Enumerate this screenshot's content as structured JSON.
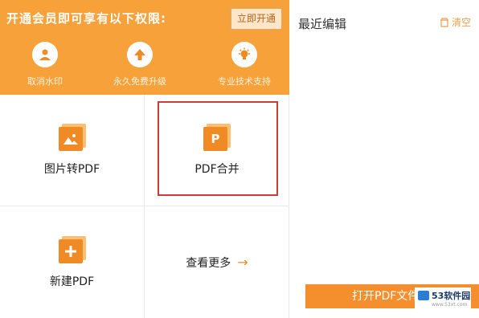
{
  "banner": {
    "title": "开通会员即可享有以下权限:",
    "activate_button": "立即开通",
    "perks": [
      {
        "label": "取消水印",
        "icon": "user-stamp-icon"
      },
      {
        "label": "永久免费升级",
        "icon": "upgrade-arrow-icon"
      },
      {
        "label": "专业技术支持",
        "icon": "support-bulb-icon"
      }
    ]
  },
  "tools": {
    "image_to_pdf": "图片转PDF",
    "pdf_merge": "PDF合并",
    "new_pdf": "新建PDF",
    "more": "查看更多",
    "more_arrow": "→",
    "merge_icon_letter": "P"
  },
  "recent": {
    "title": "最近编辑",
    "clear": "清空"
  },
  "open_button": "打开PDF文件",
  "watermark": {
    "brand": "53软件园",
    "url": "www.53xt.com"
  },
  "colors": {
    "accent": "#f7a13a",
    "accent_dark": "#f08a24",
    "highlight_border": "#d23b33"
  }
}
